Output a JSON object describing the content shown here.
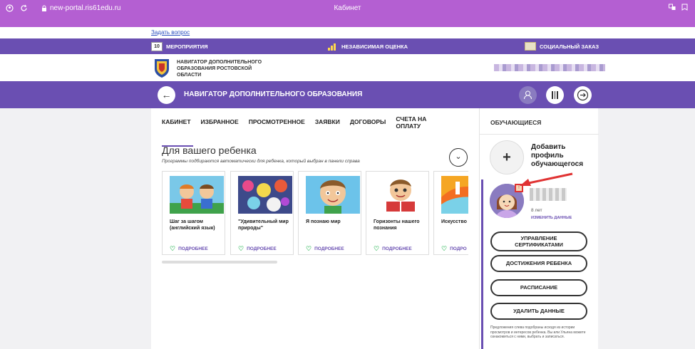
{
  "browser": {
    "url": "new-portal.ris61edu.ru",
    "title": "Кабинет"
  },
  "ask": {
    "label": "Задать вопрос"
  },
  "topnav": {
    "events_label": "МЕРОПРИЯТИЯ",
    "events_day": "10",
    "assessment_label": "НЕЗАВИСИМАЯ ОЦЕНКА",
    "social_label": "СОЦИАЛЬНЫЙ ЗАКАЗ"
  },
  "header": {
    "title": "НАВИГАТОР ДОПОЛНИТЕЛЬНОГО ОБРАЗОВАНИЯ РОСТОВСКОЙ ОБЛАСТИ"
  },
  "banner": {
    "back_glyph": "←",
    "title": "НАВИГАТОР ДОПОЛНИТЕЛЬНОГО ОБРАЗОВАНИЯ",
    "exit_glyph": "→"
  },
  "tabs": [
    {
      "label": "КАБИНЕТ",
      "active": true
    },
    {
      "label": "ИЗБРАННОЕ",
      "active": false
    },
    {
      "label": "ПРОСМОТРЕННОЕ",
      "active": false
    },
    {
      "label": "ЗАЯВКИ",
      "active": false
    },
    {
      "label": "ДОГОВОРЫ",
      "active": false
    },
    {
      "label": "СЧЕТА НА ОПЛАТУ",
      "active": false
    }
  ],
  "section": {
    "title": "Для вашего ребенка",
    "subtitle": "Программы подбираются автоматически для ребенка, который выбран в панели справа",
    "collapse_glyph": "⌄"
  },
  "cards": [
    {
      "title": "Шаг за шагом (английский язык)",
      "more": "ПОДРОБНЕЕ"
    },
    {
      "title": "\"Удивительный мир природы\"",
      "more": "ПОДРОБНЕЕ"
    },
    {
      "title": "Я познаю мир",
      "more": "ПОДРОБНЕЕ"
    },
    {
      "title": "Горизонты нашего познания",
      "more": "ПОДРОБНЕЕ"
    },
    {
      "title": "Искусство хореограф",
      "more": "ПОДРО"
    }
  ],
  "aside": {
    "title": "ОБУЧАЮЩИЕСЯ",
    "add_label": "Добавить профиль обучающегося",
    "add_glyph": "+",
    "age": "8 лет",
    "edit": "ИЗМЕНИТЬ ДАННЫЕ",
    "buttons": [
      "УПРАВЛЕНИЕ СЕРТИФИКАТАМИ",
      "ДОСТИЖЕНИЯ РЕБЕНКА",
      "РАСПИСАНИЕ",
      "УДАЛИТЬ ДАННЫЕ"
    ],
    "footnote": "Предложения слева подобраны исходя из истории просмотров и интересов ребенка. Вы или Ульяна можете ознакомиться с ними, выбрать и записаться."
  },
  "colors": {
    "brand": "#6a4fb2",
    "browser": "#b45fd2",
    "heart": "#55c477",
    "highlight": "#e03232"
  }
}
